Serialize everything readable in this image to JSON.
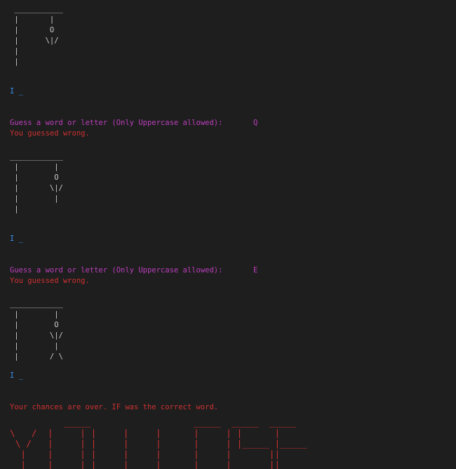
{
  "colors": {
    "background": "#1e1e1e",
    "gallows": "#cccccc",
    "word": "#3b8eea",
    "prompt": "#bc3fbc",
    "error": "#cd3131"
  },
  "rounds": [
    {
      "gallows": " ___________\n |       |\n |       O\n |      \\|/\n |\n |",
      "word": "I _",
      "prompt": "Guess a word or letter (Only Uppercase allowed):",
      "guess": "Q",
      "result": "You guessed wrong."
    },
    {
      "gallows": "____________\n |        |\n |        O\n |       \\|/\n |        |\n |",
      "word": "I _",
      "prompt": "Guess a word or letter (Only Uppercase allowed):",
      "guess": "E",
      "result": "You guessed wrong."
    }
  ],
  "final": {
    "gallows": "____________\n |        |\n |        O\n |       \\|/\n |        |\n |       / \\",
    "word": "I _",
    "message": "Your chances are over. IF was the correct word.",
    "banner": "          _____                   _____  _____  _____\n\\   /  |     | |     |     |      |     | |      |\n \\ /   |     | |     |     |      |     | |_____ |_____\n  |    |     | |     |     |      |     |       ||\n  |    |_____| |_____|     |_____ |_____|  _____||_____"
  }
}
